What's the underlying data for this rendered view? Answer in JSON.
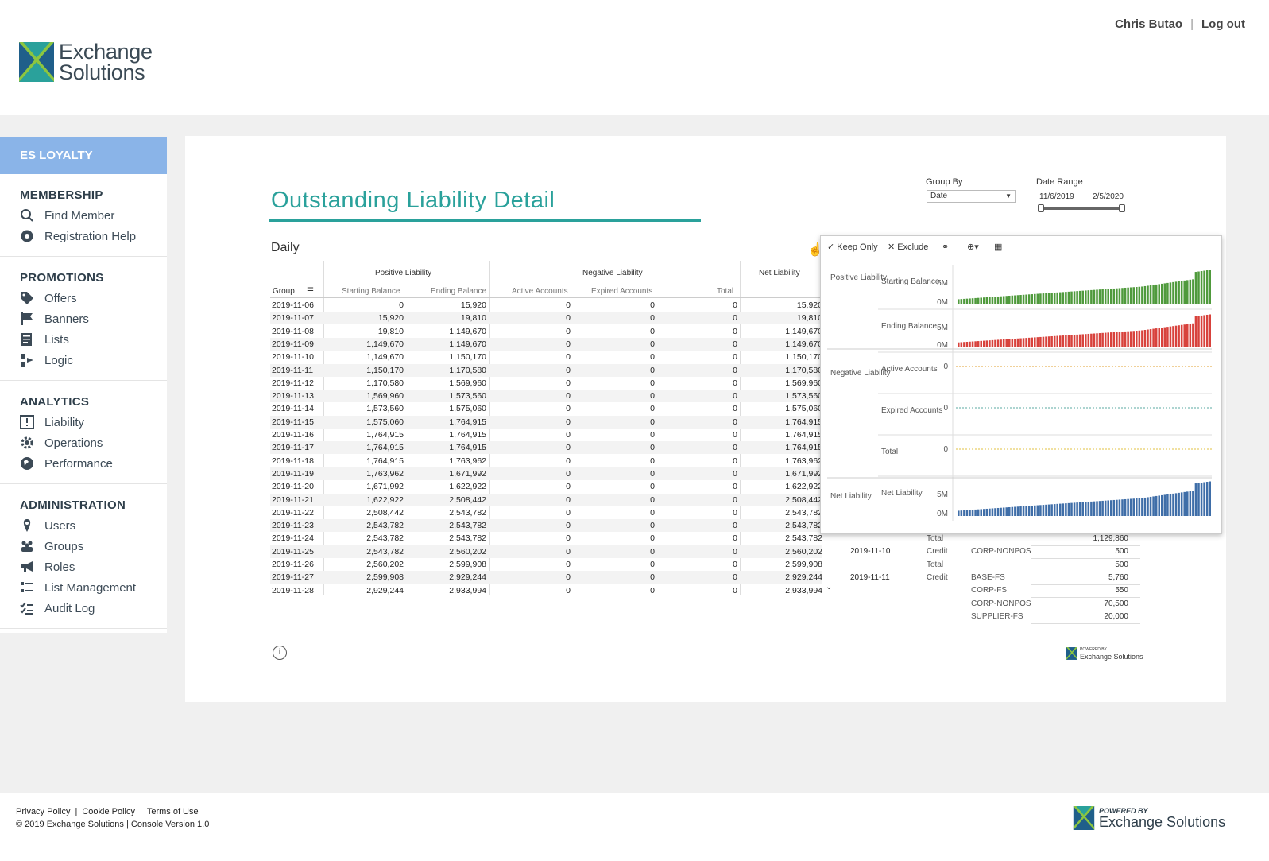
{
  "header": {
    "logo_line1": "Exchange",
    "logo_line2": "Solutions",
    "user_name": "Chris Butao",
    "logout": "Log out"
  },
  "sidebar": {
    "top": "ES LOYALTY",
    "groups": [
      {
        "heading": "MEMBERSHIP",
        "items": [
          {
            "label": "Find Member",
            "icon": "search-icon"
          },
          {
            "label": "Registration Help",
            "icon": "lifebuoy-icon"
          }
        ]
      },
      {
        "heading": "PROMOTIONS",
        "items": [
          {
            "label": "Offers",
            "icon": "tag-icon"
          },
          {
            "label": "Banners",
            "icon": "flag-icon"
          },
          {
            "label": "Lists",
            "icon": "list-icon"
          },
          {
            "label": "Logic",
            "icon": "logic-icon"
          }
        ]
      },
      {
        "heading": "ANALYTICS",
        "items": [
          {
            "label": "Liability",
            "icon": "alert-icon"
          },
          {
            "label": "Operations",
            "icon": "gear-icon"
          },
          {
            "label": "Performance",
            "icon": "globe-icon"
          }
        ]
      },
      {
        "heading": "ADMINISTRATION",
        "items": [
          {
            "label": "Users",
            "icon": "pin-icon"
          },
          {
            "label": "Groups",
            "icon": "group-icon"
          },
          {
            "label": "Roles",
            "icon": "megaphone-icon"
          },
          {
            "label": "List Management",
            "icon": "list-manage-icon"
          },
          {
            "label": "Audit Log",
            "icon": "checklist-icon"
          }
        ]
      }
    ]
  },
  "main": {
    "title": "Outstanding Liability Detail",
    "group_by_label": "Group By",
    "group_by_value": "Date",
    "date_range_label": "Date Range",
    "date_start": "11/6/2019",
    "date_end": "2/5/2020",
    "section": "Daily"
  },
  "table": {
    "group_headers": [
      "Positive Liability",
      "Negative Liability",
      "Net Liability"
    ],
    "columns": [
      "Group",
      "Starting Balance",
      "Ending Balance",
      "Active Accounts",
      "Expired Accounts",
      "Total"
    ],
    "rows": [
      [
        "2019-11-06",
        "0",
        "15,920",
        "0",
        "0",
        "0",
        "15,920"
      ],
      [
        "2019-11-07",
        "15,920",
        "19,810",
        "0",
        "0",
        "0",
        "19,810"
      ],
      [
        "2019-11-08",
        "19,810",
        "1,149,670",
        "0",
        "0",
        "0",
        "1,149,670"
      ],
      [
        "2019-11-09",
        "1,149,670",
        "1,149,670",
        "0",
        "0",
        "0",
        "1,149,670"
      ],
      [
        "2019-11-10",
        "1,149,670",
        "1,150,170",
        "0",
        "0",
        "0",
        "1,150,170"
      ],
      [
        "2019-11-11",
        "1,150,170",
        "1,170,580",
        "0",
        "0",
        "0",
        "1,170,580"
      ],
      [
        "2019-11-12",
        "1,170,580",
        "1,569,960",
        "0",
        "0",
        "0",
        "1,569,960"
      ],
      [
        "2019-11-13",
        "1,569,960",
        "1,573,560",
        "0",
        "0",
        "0",
        "1,573,560"
      ],
      [
        "2019-11-14",
        "1,573,560",
        "1,575,060",
        "0",
        "0",
        "0",
        "1,575,060"
      ],
      [
        "2019-11-15",
        "1,575,060",
        "1,764,915",
        "0",
        "0",
        "0",
        "1,764,915"
      ],
      [
        "2019-11-16",
        "1,764,915",
        "1,764,915",
        "0",
        "0",
        "0",
        "1,764,915"
      ],
      [
        "2019-11-17",
        "1,764,915",
        "1,764,915",
        "0",
        "0",
        "0",
        "1,764,915"
      ],
      [
        "2019-11-18",
        "1,764,915",
        "1,763,962",
        "0",
        "0",
        "0",
        "1,763,962"
      ],
      [
        "2019-11-19",
        "1,763,962",
        "1,671,992",
        "0",
        "0",
        "0",
        "1,671,992"
      ],
      [
        "2019-11-20",
        "1,671,992",
        "1,622,922",
        "0",
        "0",
        "0",
        "1,622,922"
      ],
      [
        "2019-11-21",
        "1,622,922",
        "2,508,442",
        "0",
        "0",
        "0",
        "2,508,442"
      ],
      [
        "2019-11-22",
        "2,508,442",
        "2,543,782",
        "0",
        "0",
        "0",
        "2,543,782"
      ],
      [
        "2019-11-23",
        "2,543,782",
        "2,543,782",
        "0",
        "0",
        "0",
        "2,543,782"
      ],
      [
        "2019-11-24",
        "2,543,782",
        "2,543,782",
        "0",
        "0",
        "0",
        "2,543,782"
      ],
      [
        "2019-11-25",
        "2,543,782",
        "2,560,202",
        "0",
        "0",
        "0",
        "2,560,202"
      ],
      [
        "2019-11-26",
        "2,560,202",
        "2,599,908",
        "0",
        "0",
        "0",
        "2,599,908"
      ],
      [
        "2019-11-27",
        "2,599,908",
        "2,929,244",
        "0",
        "0",
        "0",
        "2,929,244"
      ],
      [
        "2019-11-28",
        "2,929,244",
        "2,933,994",
        "0",
        "0",
        "0",
        "2,933,994"
      ]
    ]
  },
  "popup": {
    "keep_only": "Keep Only",
    "exclude": "Exclude",
    "sections": [
      "Positive Liability",
      "Negative Liability",
      "Net Liability"
    ],
    "rows": [
      {
        "label": "Starting Balance",
        "ticks": [
          "5M",
          "0M"
        ],
        "color": "#4f9a3c"
      },
      {
        "label": "Ending Balance",
        "ticks": [
          "5M",
          "0M"
        ],
        "color": "#d8423c"
      },
      {
        "label": "Active Accounts",
        "ticks": [
          "0"
        ],
        "color": "#e0a030"
      },
      {
        "label": "Expired Accounts",
        "ticks": [
          "0"
        ],
        "color": "#5aa9a0"
      },
      {
        "label": "Total",
        "ticks": [
          "0"
        ],
        "color": "#e0c040"
      },
      {
        "label": "Net Liability",
        "ticks": [
          "5M",
          "0M"
        ],
        "color": "#3f6ea8"
      }
    ]
  },
  "mini_table": {
    "rows": [
      {
        "date": "",
        "type": "Total",
        "code": "",
        "value": "1,129,860"
      },
      {
        "date": "2019-11-10",
        "type": "Credit",
        "code": "CORP-NONPOS",
        "value": "500"
      },
      {
        "date": "",
        "type": "Total",
        "code": "",
        "value": "500"
      },
      {
        "date": "2019-11-11",
        "type": "Credit",
        "code": "BASE-FS",
        "value": "5,760"
      },
      {
        "date": "",
        "type": "",
        "code": "CORP-FS",
        "value": "550"
      },
      {
        "date": "",
        "type": "",
        "code": "CORP-NONPOS",
        "value": "70,500"
      },
      {
        "date": "",
        "type": "",
        "code": "SUPPLIER-FS",
        "value": "20,000"
      }
    ]
  },
  "powered": {
    "line1": "POWERED BY",
    "line2": "Exchange Solutions"
  },
  "footer": {
    "privacy": "Privacy Policy",
    "cookie": "Cookie Policy",
    "terms": "Terms of Use",
    "copyright": "© 2019 Exchange Solutions | Console Version 1.0"
  }
}
